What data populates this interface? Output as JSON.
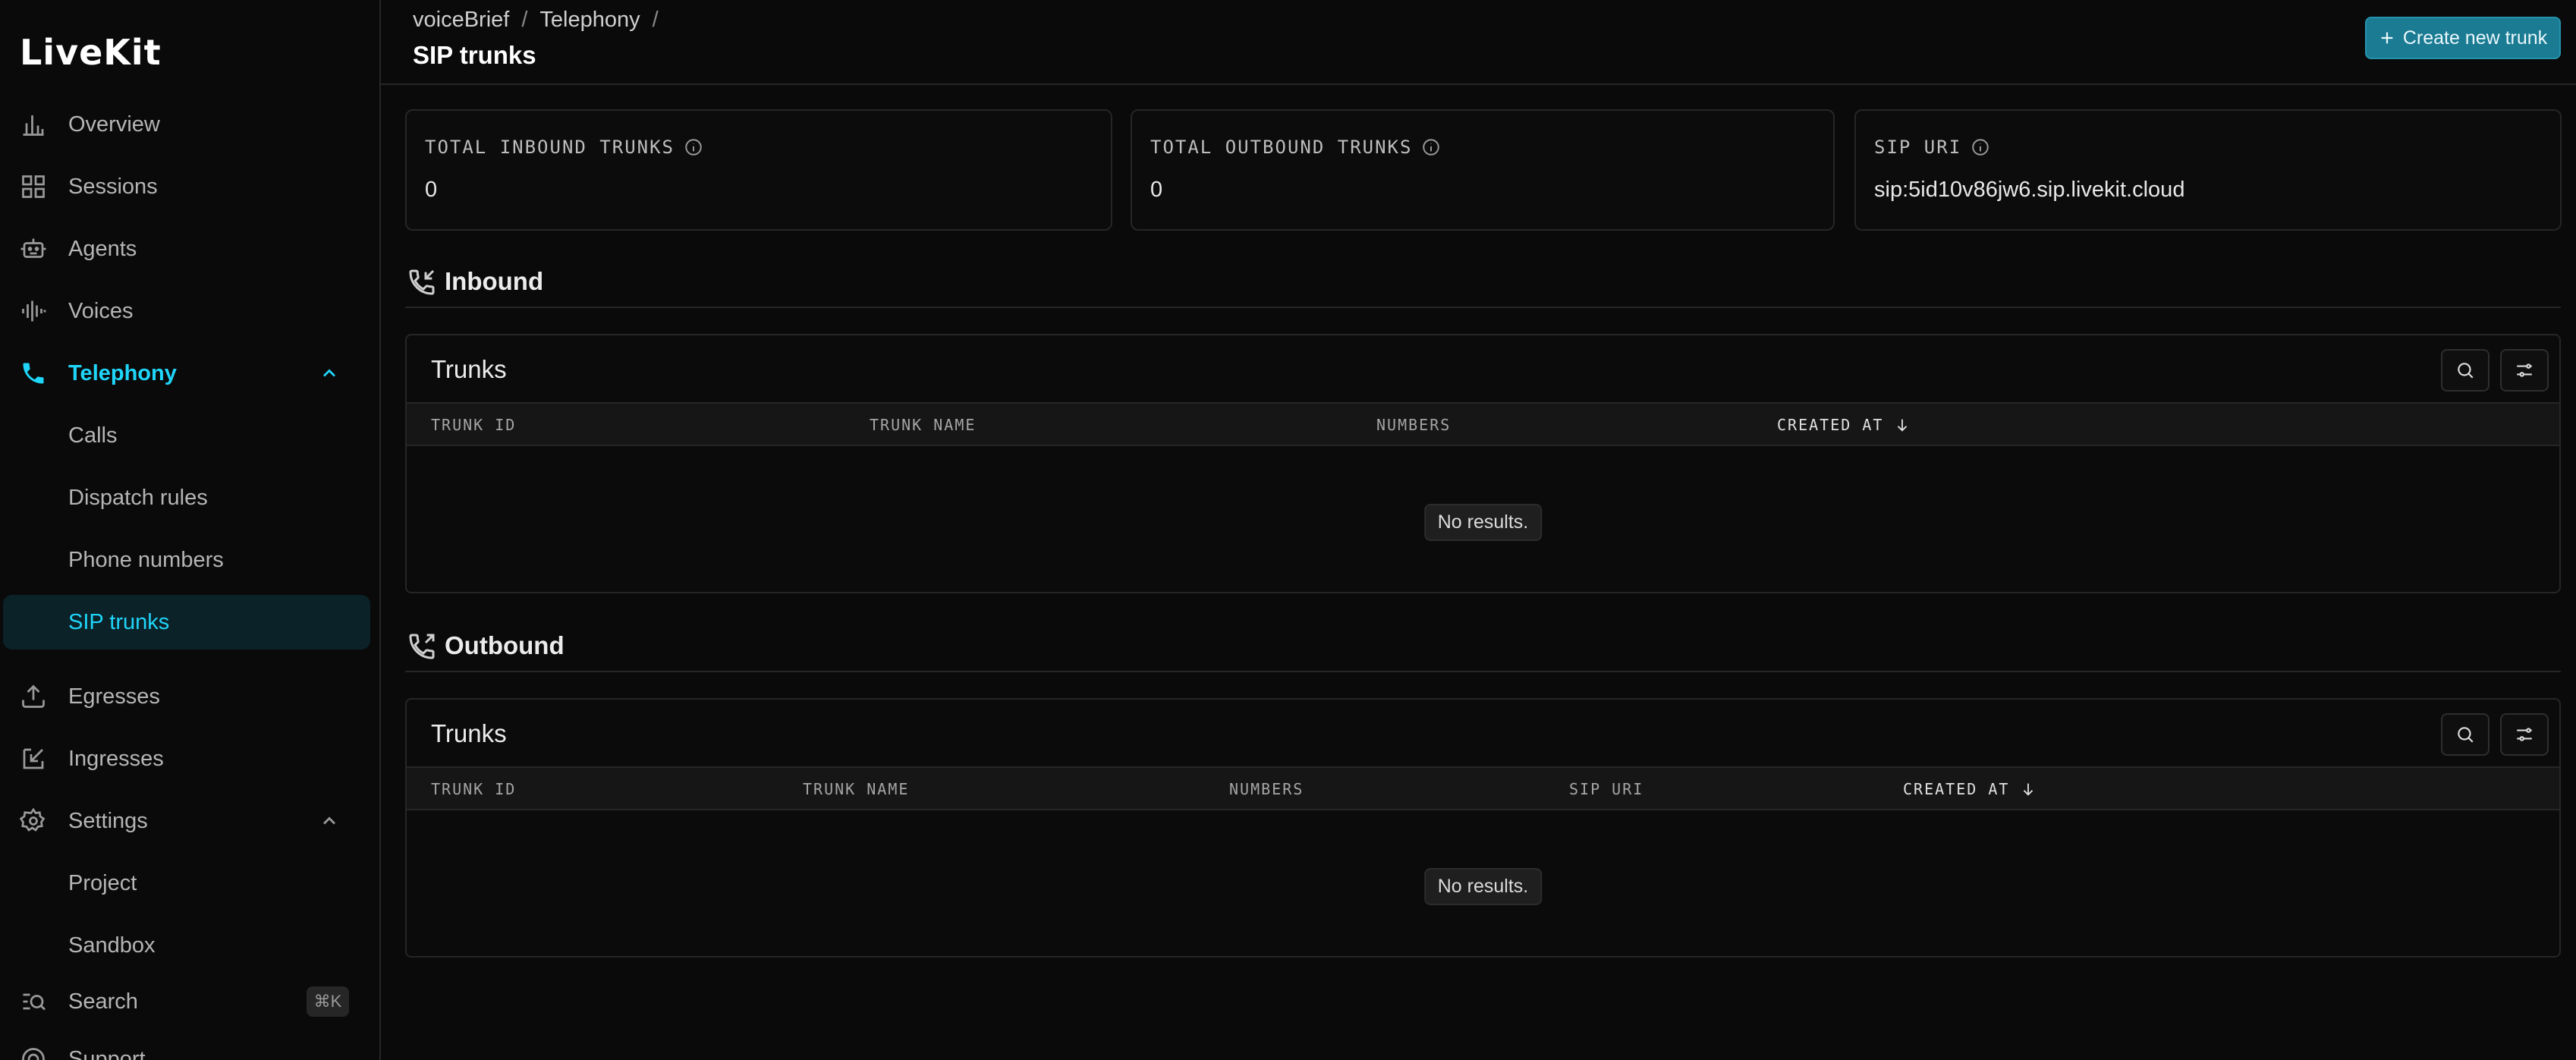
{
  "app": {
    "logo_text": "LiveKit"
  },
  "sidebar": {
    "items": [
      {
        "label": "Overview",
        "icon": "bar-chart-icon"
      },
      {
        "label": "Sessions",
        "icon": "grid-icon"
      },
      {
        "label": "Agents",
        "icon": "robot-icon"
      },
      {
        "label": "Voices",
        "icon": "waveform-icon"
      },
      {
        "label": "Telephony",
        "icon": "phone-icon"
      },
      {
        "label": "Calls"
      },
      {
        "label": "Dispatch rules"
      },
      {
        "label": "Phone numbers"
      },
      {
        "label": "SIP trunks"
      },
      {
        "label": "Egresses",
        "icon": "upload-icon"
      },
      {
        "label": "Ingresses",
        "icon": "import-icon"
      },
      {
        "label": "Settings",
        "icon": "gear-icon"
      },
      {
        "label": "Project"
      },
      {
        "label": "Sandbox"
      },
      {
        "label": "Search",
        "icon": "search-list-icon",
        "shortcut": "⌘K"
      },
      {
        "label": "Support",
        "icon": "lifebuoy-icon"
      }
    ]
  },
  "header": {
    "breadcrumb": [
      "voiceBrief",
      "Telephony"
    ],
    "breadcrumb_sep": "/",
    "title": "SIP trunks",
    "create_button": "Create new trunk"
  },
  "stats": [
    {
      "label": "TOTAL INBOUND TRUNKS",
      "value": "0"
    },
    {
      "label": "TOTAL OUTBOUND TRUNKS",
      "value": "0"
    },
    {
      "label": "SIP URI",
      "value": "sip:5id10v86jw6.sip.livekit.cloud"
    }
  ],
  "inbound": {
    "section_title": "Inbound",
    "table_title": "Trunks",
    "columns": [
      "TRUNK ID",
      "TRUNK NAME",
      "NUMBERS",
      "CREATED AT"
    ],
    "empty_text": "No results."
  },
  "outbound": {
    "section_title": "Outbound",
    "table_title": "Trunks",
    "columns": [
      "TRUNK ID",
      "TRUNK NAME",
      "NUMBERS",
      "SIP URI",
      "CREATED AT"
    ],
    "empty_text": "No results."
  },
  "colors": {
    "accent": "#1fd5f9",
    "button": "#1a7b93",
    "background": "#0a0a0a",
    "border": "#262626"
  }
}
